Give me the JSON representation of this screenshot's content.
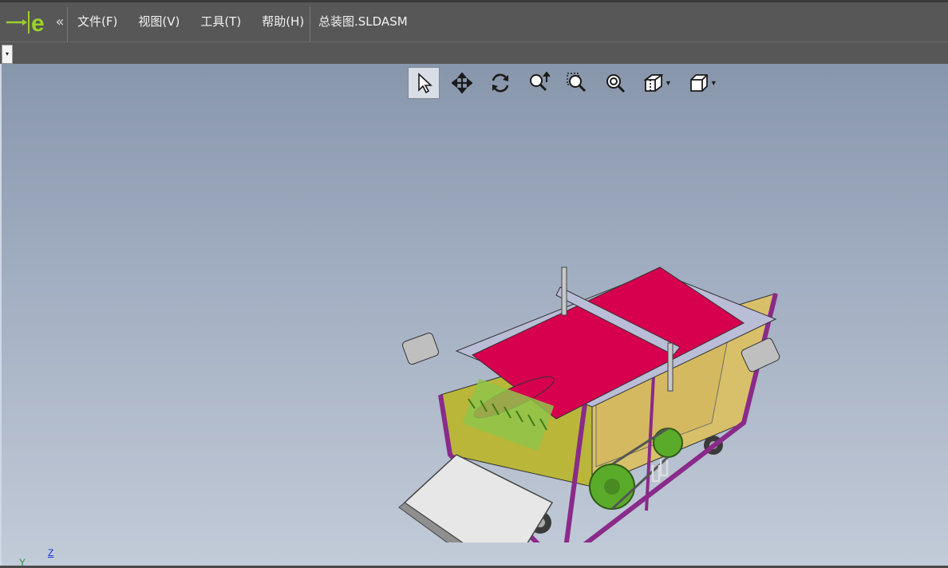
{
  "menubar": {
    "logo": "logo-e-icon",
    "collapse_icon": "«",
    "items": [
      {
        "label": "文件(F)"
      },
      {
        "label": "视图(V)"
      },
      {
        "label": "工具(T)"
      },
      {
        "label": "帮助(H)"
      }
    ],
    "document_title": "总装图.SLDASM"
  },
  "toolbar2": {
    "dropdown_icon": "▾"
  },
  "heads_up_toolbar": {
    "tools": [
      {
        "name": "select-icon",
        "active": true
      },
      {
        "name": "pan-icon"
      },
      {
        "name": "rotate-icon"
      },
      {
        "name": "zoom-in-out-icon"
      },
      {
        "name": "zoom-to-area-icon"
      },
      {
        "name": "zoom-to-fit-icon"
      },
      {
        "name": "section-view-icon",
        "has_dropdown": true
      },
      {
        "name": "view-orientation-icon",
        "has_dropdown": true
      }
    ]
  },
  "triad": {
    "z": "Z",
    "y": "Y"
  },
  "colors": {
    "belt": "#d6004f",
    "frame": "#8a2a8a",
    "panel": "#b7b53a",
    "cover": "#c9c9ce",
    "gear": "#5aab2a"
  }
}
